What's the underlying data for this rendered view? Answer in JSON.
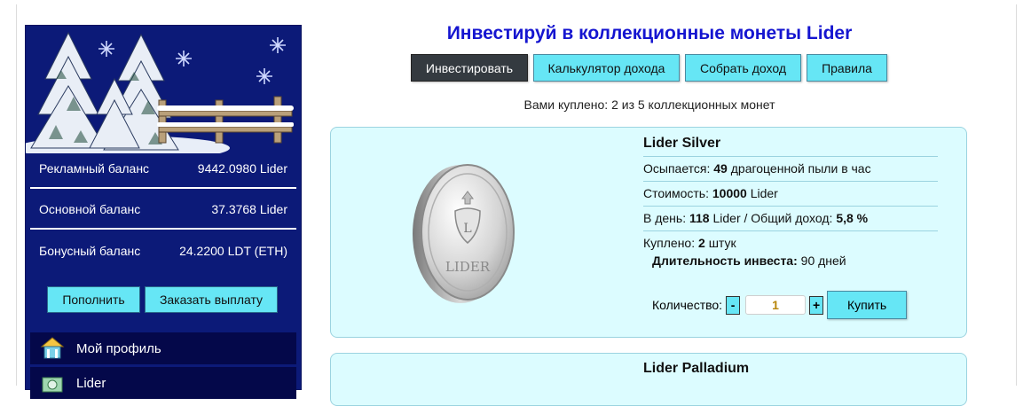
{
  "sidebar": {
    "balances": [
      {
        "label": "Рекламный баланс",
        "value": "9442.0980 Lider"
      },
      {
        "label": "Основной баланс",
        "value": "37.3768 Lider"
      },
      {
        "label": "Бонусный баланс",
        "value": "24.2200 LDT (ETH)"
      }
    ],
    "topup_label": "Пополнить",
    "withdraw_label": "Заказать выплату",
    "menu": [
      {
        "label": "Мой профиль",
        "icon": "house-icon"
      },
      {
        "label": "Lider",
        "icon": "coins-icon"
      }
    ]
  },
  "main": {
    "title": "Инвестируй в коллекционные монеты Lider",
    "tabs": [
      {
        "label": "Инвестировать",
        "active": true
      },
      {
        "label": "Калькулятор дохода",
        "active": false
      },
      {
        "label": "Собрать доход",
        "active": false
      },
      {
        "label": "Правила",
        "active": false
      }
    ],
    "status": "Вами куплено: 2 из 5 коллекционных монет",
    "cards": [
      {
        "name": "Lider Silver",
        "coin_text": "LIDER",
        "rate_prefix": "Осыпается:",
        "rate_value": "49",
        "rate_suffix": "драгоценной пыли в час",
        "cost_prefix": "Стоимость:",
        "cost_value": "10000",
        "cost_suffix": "Lider",
        "day_prefix": "В день:",
        "day_value": "118",
        "day_mid": "Lider / Общий доход:",
        "day_total": "5,8 %",
        "bought_prefix": "Куплено:",
        "bought_value": "2",
        "bought_suffix": "штук",
        "duration_label": "Длительность инвеста:",
        "duration_value": "90 дней",
        "qty_label": "Количество:",
        "minus": "-",
        "qty_value": "1",
        "plus": "+",
        "buy_label": "Купить"
      },
      {
        "name": "Lider Palladium"
      }
    ]
  },
  "colors": {
    "sidebar_bg": "#0c1a78",
    "accent_button": "#66e6f5",
    "title_blue": "#1515d0",
    "card_bg": "#dcfcff",
    "active_tab": "#343a40"
  }
}
